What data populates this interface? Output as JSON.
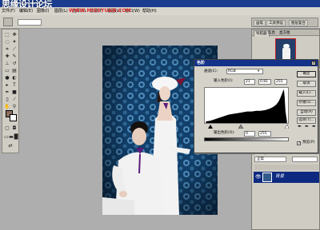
{
  "titlebar": {
    "logo": "思缘设计论坛",
    "watermark": "WWW.MISSYUAN.COM"
  },
  "menubar": {
    "items": [
      "文件(F)",
      "编辑(E)",
      "图像(I)",
      "图层(L)",
      "选择(S)",
      "滤镜(T)",
      "视图(V)",
      "窗口(W)",
      "帮助(H)"
    ]
  },
  "options_bar": {
    "well_tabs": [
      "画笔",
      "工具预设",
      "图层复合"
    ]
  },
  "panels": {
    "navigator": {
      "tabs": [
        "导航器",
        "信息",
        "直方图"
      ]
    },
    "layers": {
      "tabs": [
        "图层",
        "通道",
        "路径"
      ],
      "blend_mode": "正常",
      "layer_name": "背景"
    }
  },
  "levels_dialog": {
    "title": "色阶",
    "channel_label": "通道(C):",
    "channel_value": "RGB",
    "input_label": "输入色阶(I):",
    "input_black": "21",
    "input_gamma": "0.81",
    "input_white": "255",
    "output_label": "输出色阶(O):",
    "output_black": "0",
    "output_white": "255",
    "buttons": {
      "ok": "确定",
      "cancel": "取消",
      "load": "载入(L)...",
      "save": "存储(S)...",
      "auto": "自动(A)",
      "options": "选项(T)..."
    },
    "preview_label": "预览(P)",
    "preview_checked": true
  }
}
